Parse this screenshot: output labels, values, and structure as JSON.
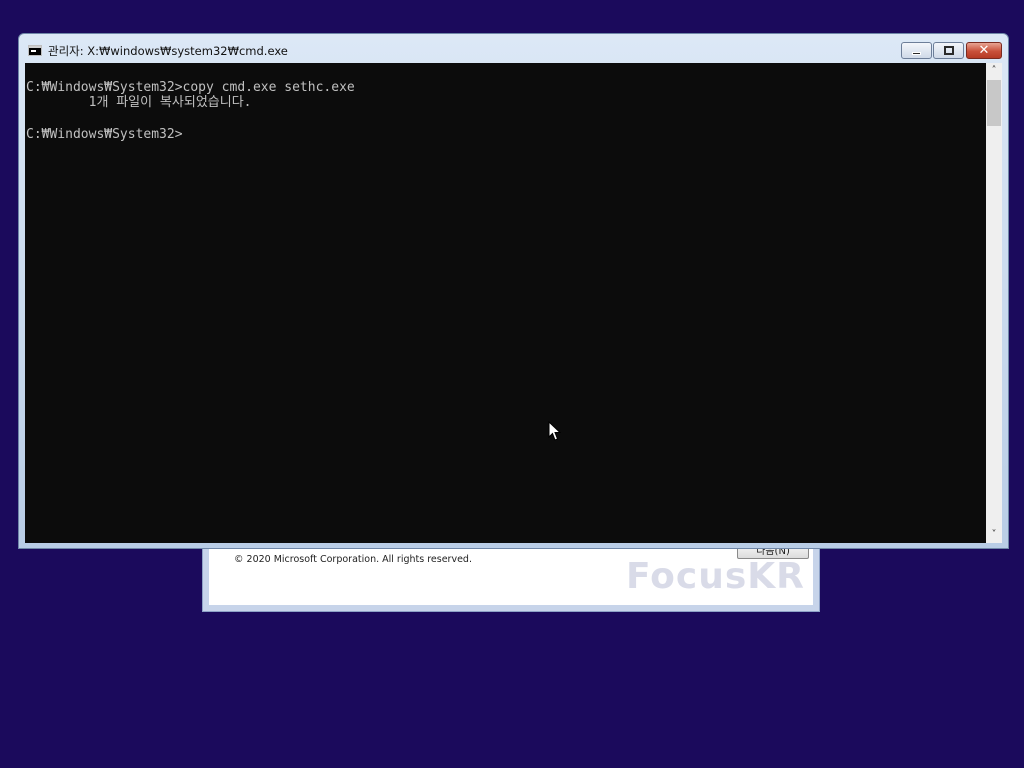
{
  "setup_dialog": {
    "copyright": "© 2020 Microsoft Corporation. All rights reserved.",
    "next_button": "다음(N)"
  },
  "watermark": {
    "text": "FocusKR"
  },
  "cmd_window": {
    "title": "관리자: X:₩windows₩system32₩cmd.exe",
    "buttons": {
      "minimize": "minimize-icon",
      "maximize": "maximize-icon",
      "close": "✕"
    },
    "console_lines": [
      "C:₩Windows₩System32>copy cmd.exe sethc.exe",
      "        1개 파일이 복사되었습니다.",
      "",
      "C:₩Windows₩System32>"
    ],
    "scrollbar": {
      "up": "˄",
      "down": "˅"
    }
  },
  "colors": {
    "desktop_background": "#1b0a5c",
    "console_background": "#0c0c0c",
    "console_text": "#c0c0c0",
    "close_button": "#c9503a",
    "watermark_teal": "#2fa89a",
    "watermark_dark": "#3a3f6a"
  }
}
